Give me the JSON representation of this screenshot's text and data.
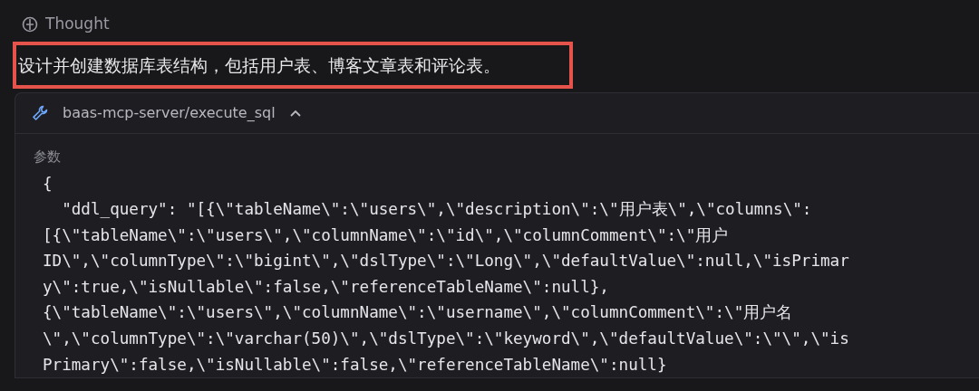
{
  "thought": {
    "label": "Thought",
    "text": "设计并创建数据库表结构，包括用户表、博客文章表和评论表。",
    "highlighted": true
  },
  "tool_call": {
    "name": "baas-mcp-server/execute_sql",
    "expanded": true,
    "params_label": "参数",
    "code_lines": [
      "{",
      "  \"ddl_query\": \"[{\\\"tableName\\\":\\\"users\\\",\\\"description\\\":\\\"用户表\\\",\\\"columns\\\":",
      "[{\\\"tableName\\\":\\\"users\\\",\\\"columnName\\\":\\\"id\\\",\\\"columnComment\\\":\\\"用户",
      "ID\\\",\\\"columnType\\\":\\\"bigint\\\",\\\"dslType\\\":\\\"Long\\\",\\\"defaultValue\\\":null,\\\"isPrimar",
      "y\\\":true,\\\"isNullable\\\":false,\\\"referenceTableName\\\":null},",
      "{\\\"tableName\\\":\\\"users\\\",\\\"columnName\\\":\\\"username\\\",\\\"columnComment\\\":\\\"用户名",
      "\\\",\\\"columnType\\\":\\\"varchar(50)\\\",\\\"dslType\\\":\\\"keyword\\\",\\\"defaultValue\\\":\\\"\\\",\\\"is",
      "Primary\\\":false,\\\"isNullable\\\":false,\\\"referenceTableName\\\":null}"
    ]
  }
}
